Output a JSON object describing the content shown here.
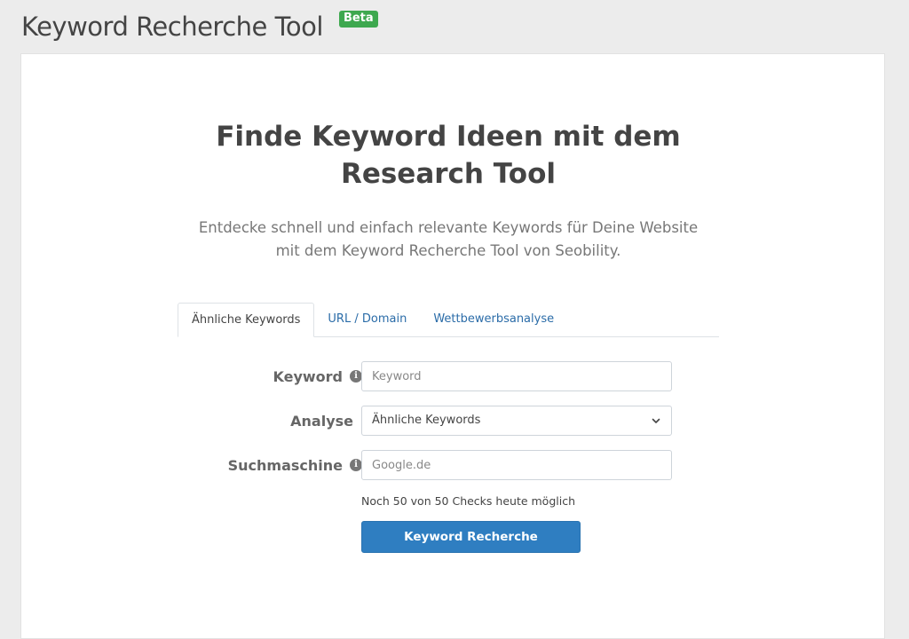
{
  "header": {
    "title": "Keyword Recherche Tool",
    "badge": "Beta"
  },
  "hero": {
    "title_line1": "Finde Keyword Ideen mit dem",
    "title_line2": "Research Tool",
    "subtitle_line1": "Entdecke schnell und einfach relevante Keywords für Deine Website",
    "subtitle_line2": "mit dem Keyword Recherche Tool von Seobility."
  },
  "tabs": [
    {
      "label": "Ähnliche Keywords",
      "active": true
    },
    {
      "label": "URL / Domain",
      "active": false
    },
    {
      "label": "Wettbewerbsanalyse",
      "active": false
    }
  ],
  "form": {
    "keyword": {
      "label": "Keyword",
      "placeholder": "Keyword",
      "value": ""
    },
    "analyse": {
      "label": "Analyse",
      "selected": "Ähnliche Keywords"
    },
    "suchmaschine": {
      "label": "Suchmaschine",
      "placeholder": "Google.de",
      "value": ""
    },
    "quota_text": "Noch 50 von 50 Checks heute möglich",
    "submit_label": "Keyword Recherche"
  },
  "colors": {
    "badge": "#3ea84f",
    "primary": "#2f7ec1",
    "link": "#2b6ca8"
  },
  "icons": {
    "info": "info-circle-icon",
    "select": "chevron-down-icon"
  }
}
